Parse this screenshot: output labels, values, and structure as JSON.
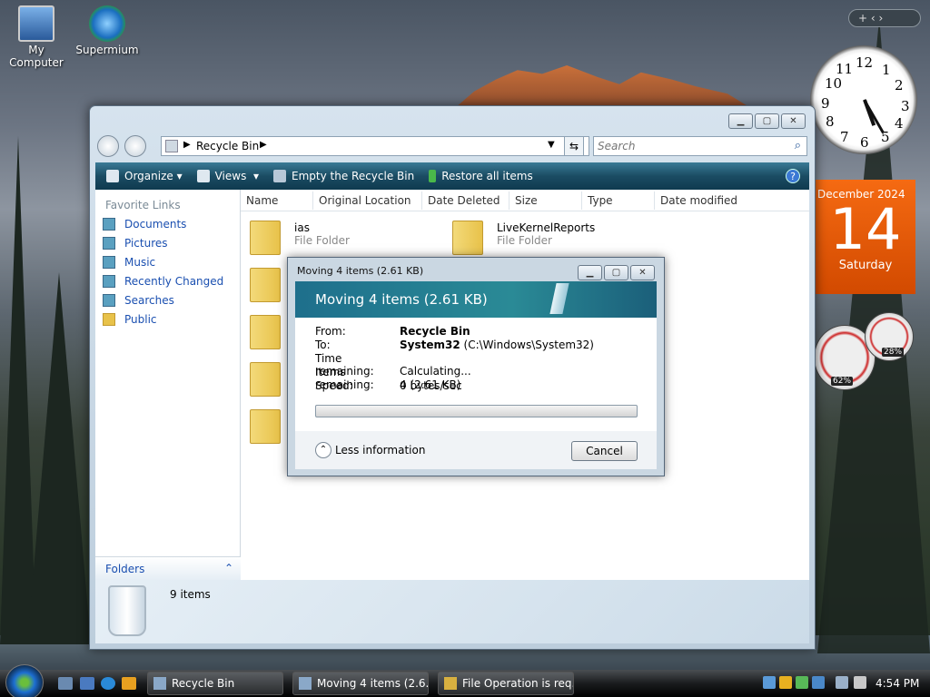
{
  "desktop": {
    "icons": [
      {
        "label": "My Computer"
      },
      {
        "label": "Supermium"
      }
    ]
  },
  "explorer": {
    "address": {
      "location": "Recycle Bin"
    },
    "search": {
      "placeholder": "Search"
    },
    "toolbar": {
      "organize": "Organize",
      "views": "Views",
      "empty": "Empty the Recycle Bin",
      "restore": "Restore all items"
    },
    "nav": {
      "header": "Favorite Links",
      "links": [
        "Documents",
        "Pictures",
        "Music",
        "Recently Changed",
        "Searches",
        "Public"
      ],
      "folders": "Folders"
    },
    "columns": [
      "Name",
      "Original Location",
      "Date Deleted",
      "Size",
      "Type",
      "Date modified"
    ],
    "items": [
      {
        "name": "ias",
        "type": "File Folder"
      },
      {
        "name": "LiveKernelReports",
        "type": "File Folder"
      }
    ],
    "details": {
      "count": "9 items"
    }
  },
  "dialog": {
    "title": "Moving 4 items (2.61 KB)",
    "header": "Moving 4 items (2.61 KB)",
    "from_label": "From:",
    "from_value": "Recycle Bin",
    "to_label": "To:",
    "to_value": "System32",
    "to_path": "(C:\\Windows\\System32)",
    "time_label": "Time remaining:",
    "time_value": "Calculating...",
    "items_label": "Items remaining:",
    "items_value": "4 (2.61 KB)",
    "speed_label": "Speed:",
    "speed_value": "0 bytes/sec",
    "progress": 0,
    "less": "Less information",
    "cancel": "Cancel"
  },
  "gadgets": {
    "clock_numbers": [
      "12",
      "1",
      "2",
      "3",
      "4",
      "5",
      "6",
      "7",
      "8",
      "9",
      "10",
      "11"
    ],
    "calendar": {
      "month": "December 2024",
      "day": "14",
      "weekday": "Saturday"
    },
    "cpu": "62%",
    "memory": "28%"
  },
  "taskbar": {
    "tasks": [
      "Recycle Bin",
      "Moving 4 items (2.6...",
      "File Operation is req..."
    ],
    "time": "4:54 PM"
  }
}
